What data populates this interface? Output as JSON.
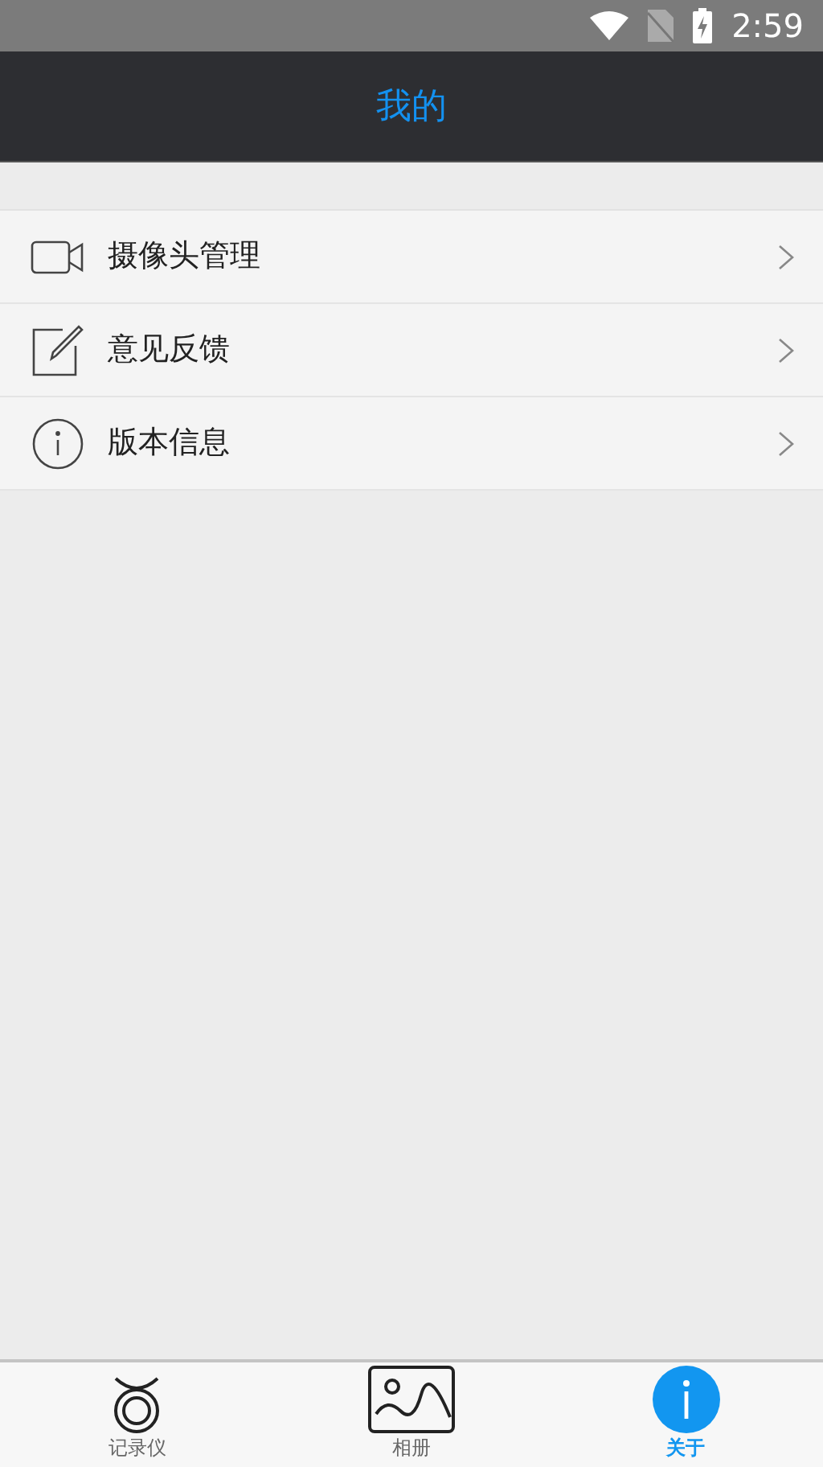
{
  "status_bar": {
    "time": "2:59"
  },
  "header": {
    "title": "我的"
  },
  "menu": [
    {
      "kind": "camera",
      "label": "摄像头管理"
    },
    {
      "kind": "edit",
      "label": "意见反馈"
    },
    {
      "kind": "info",
      "label": "版本信息"
    }
  ],
  "tabs": [
    {
      "kind": "recorder",
      "label": "记录仪",
      "selected": false
    },
    {
      "kind": "album",
      "label": "相册",
      "selected": false
    },
    {
      "kind": "about",
      "label": "关于",
      "selected": true
    }
  ]
}
